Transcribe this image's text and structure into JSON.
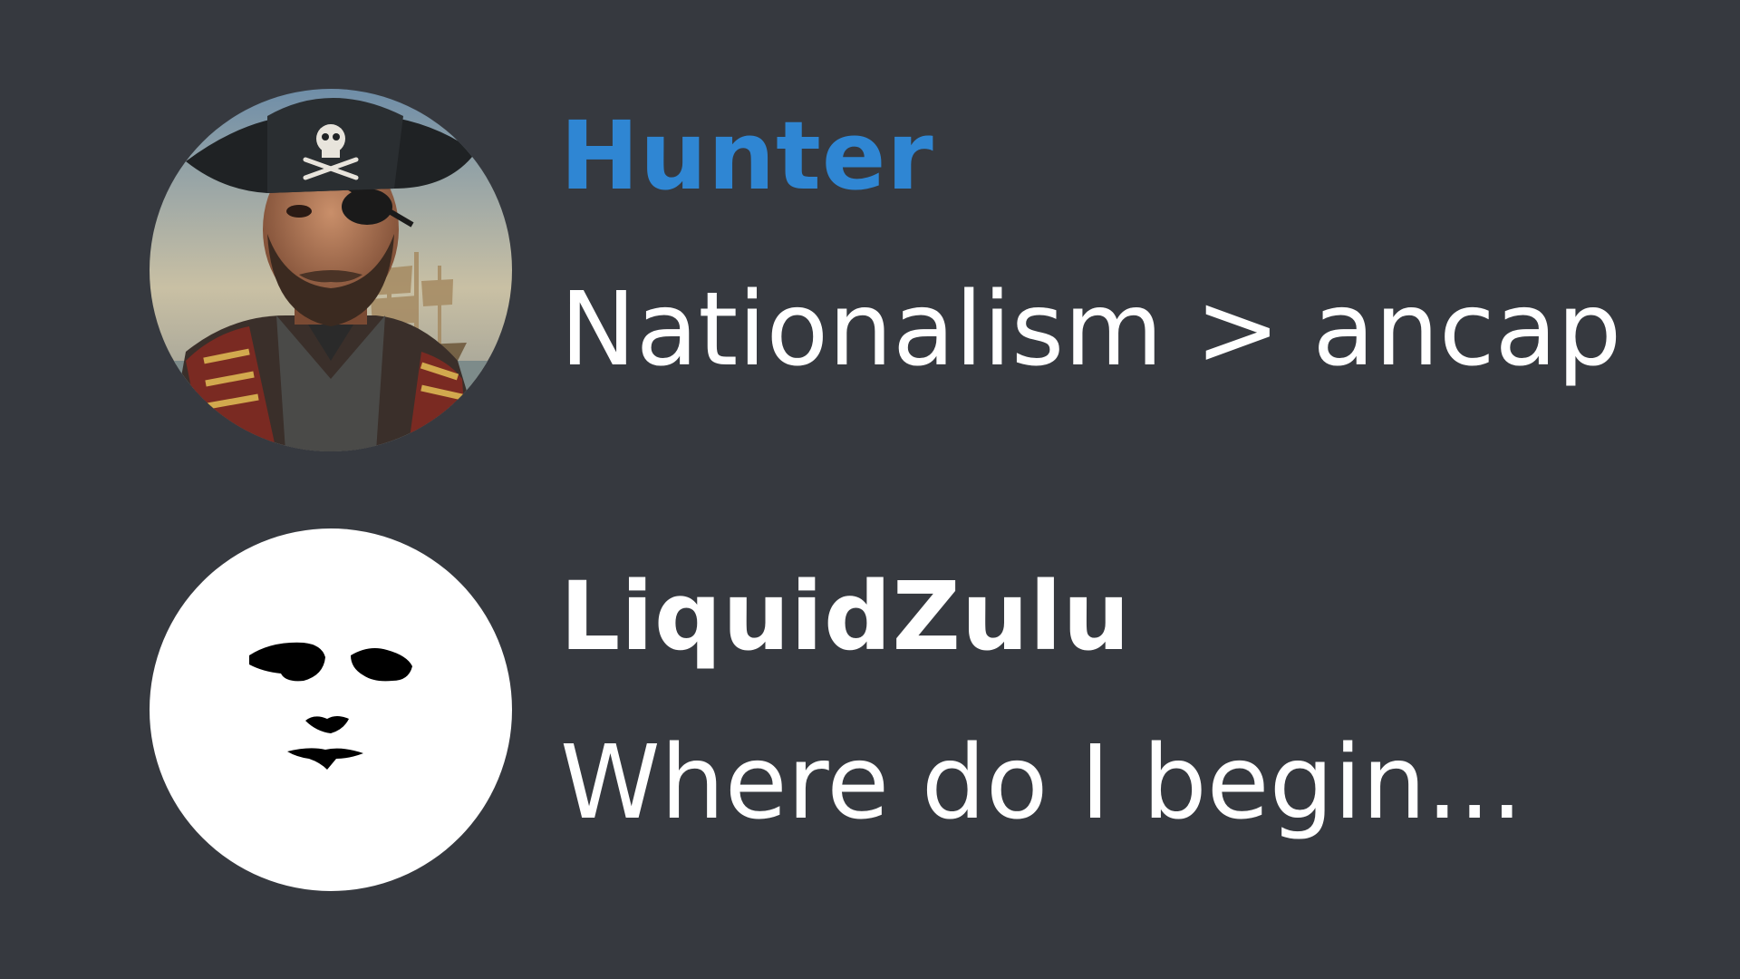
{
  "colors": {
    "background": "#36393f",
    "hunter_name": "#2f86d3",
    "default_name": "#ffffff",
    "message_text": "#ffffff",
    "white_avatar_bg": "#ffffff"
  },
  "messages": [
    {
      "username": "Hunter",
      "avatar_icon": "pirate-captain-avatar",
      "text": "Nationalism > ancap"
    },
    {
      "username": "LiquidZulu",
      "avatar_icon": "minimal-face-avatar",
      "text": "Where do I begin..."
    }
  ]
}
